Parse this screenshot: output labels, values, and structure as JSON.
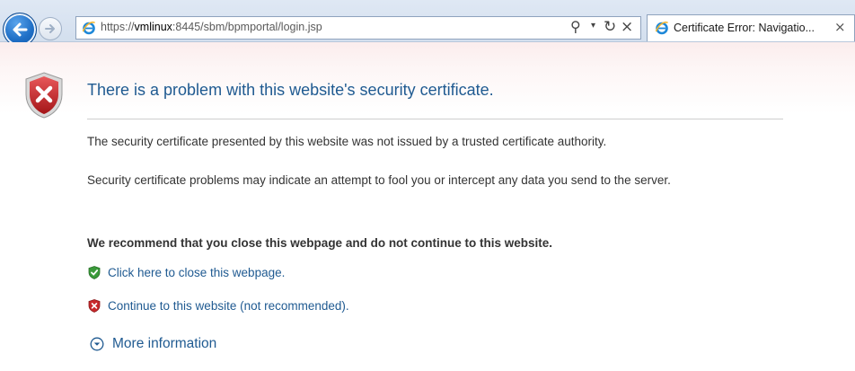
{
  "browser": {
    "address": {
      "url_prefix": "https://",
      "url_host": "vmlinux",
      "url_rest": ":8445/sbm/bpmportal/login.jsp"
    },
    "tab": {
      "title": "Certificate Error: Navigatio...",
      "close_glyph": "×"
    },
    "controls": {
      "search_glyph": "⚲",
      "dropdown_glyph": "▾",
      "refresh_glyph": "↻",
      "stop_glyph": "×"
    }
  },
  "page": {
    "title": "There is a problem with this website's security certificate.",
    "paragraph1": "The security certificate presented by this website was not issued by a trusted certificate authority.",
    "paragraph2": "Security certificate problems may indicate an attempt to fool you or intercept any data you send to the server.",
    "recommendation": "We recommend that you close this webpage and do not continue to this website.",
    "close_link": "Click here to close this webpage.",
    "continue_link": "Continue to this website (not recommended).",
    "more_info": "More information"
  },
  "colors": {
    "link": "#1f5a91",
    "shield_red": "#c8282b",
    "ok_green": "#3a9a3a"
  },
  "icons": {
    "back": "back-arrow-icon",
    "forward": "forward-arrow-icon",
    "ie": "internet-explorer-icon",
    "shield": "red-shield-x-icon",
    "green_shield": "green-shield-check-icon",
    "red_shield_small": "red-shield-x-small-icon",
    "expand": "expand-chevron-icon"
  }
}
